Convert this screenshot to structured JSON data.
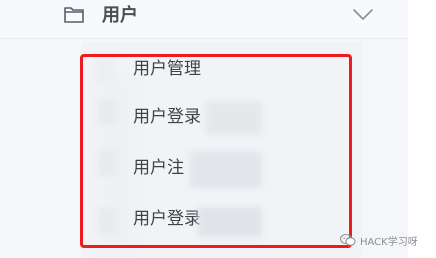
{
  "menu": {
    "group_title": "用户",
    "items": [
      {
        "label": "用户管理"
      },
      {
        "label": "用户登录"
      },
      {
        "label": "用户注"
      },
      {
        "label": "用户登录"
      }
    ]
  },
  "icons": {
    "folder": "folder-icon",
    "chevron": "chevron-down-icon",
    "watermark": "wechat-icon"
  },
  "watermark": {
    "text": "HACK学习呀"
  },
  "colors": {
    "highlight_border": "#ee1c1c"
  }
}
